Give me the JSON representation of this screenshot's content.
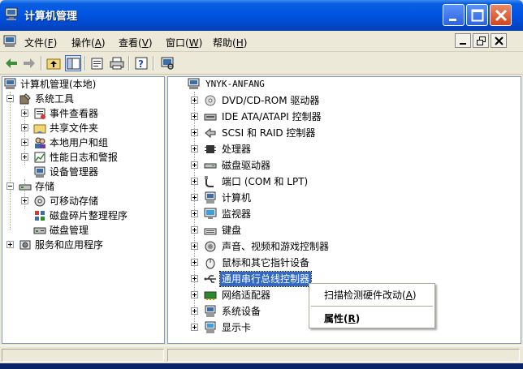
{
  "window": {
    "title": "计算机管理"
  },
  "menu": [
    {
      "label": "文件(",
      "key": "F",
      "end": ")"
    },
    {
      "label": "操作(",
      "key": "A",
      "end": ")"
    },
    {
      "label": "查看(",
      "key": "V",
      "end": ")"
    },
    {
      "label": "窗口(",
      "key": "W",
      "end": ")"
    },
    {
      "label": "帮助(",
      "key": "H",
      "end": ")"
    }
  ],
  "left_tree": [
    {
      "label": "计算机管理(本地)",
      "icon": "computer-management-icon"
    },
    {
      "label": "系统工具",
      "icon": "system-tools-icon"
    },
    {
      "label": "事件查看器",
      "icon": "event-viewer-icon"
    },
    {
      "label": "共享文件夹",
      "icon": "shared-folder-icon"
    },
    {
      "label": "本地用户和组",
      "icon": "users-icon"
    },
    {
      "label": "性能日志和警报",
      "icon": "performance-icon"
    },
    {
      "label": "设备管理器",
      "icon": "device-manager-icon"
    },
    {
      "label": "存储",
      "icon": "storage-icon"
    },
    {
      "label": "可移动存储",
      "icon": "removable-storage-icon"
    },
    {
      "label": "磁盘碎片整理程序",
      "icon": "defrag-icon"
    },
    {
      "label": "磁盘管理",
      "icon": "disk-management-icon"
    },
    {
      "label": "服务和应用程序",
      "icon": "services-icon"
    }
  ],
  "right_tree": {
    "root": "YNYK-ANFANG",
    "items": [
      {
        "label": "DVD/CD-ROM 驱动器",
        "icon": "cdrom-icon"
      },
      {
        "label": "IDE ATA/ATAPI 控制器",
        "icon": "ide-controller-icon"
      },
      {
        "label": "SCSI 和 RAID 控制器",
        "icon": "scsi-icon"
      },
      {
        "label": "处理器",
        "icon": "processor-icon"
      },
      {
        "label": "磁盘驱动器",
        "icon": "disk-drive-icon"
      },
      {
        "label": "端口 (COM 和 LPT)",
        "icon": "port-icon"
      },
      {
        "label": "计算机",
        "icon": "computer-icon"
      },
      {
        "label": "监视器",
        "icon": "monitor-icon"
      },
      {
        "label": "键盘",
        "icon": "keyboard-icon"
      },
      {
        "label": "声音、视频和游戏控制器",
        "icon": "sound-icon"
      },
      {
        "label": "鼠标和其它指针设备",
        "icon": "mouse-icon"
      },
      {
        "label": "通用串行总线控制器",
        "icon": "usb-icon"
      },
      {
        "label": "网络适配器",
        "icon": "network-icon"
      },
      {
        "label": "系统设备",
        "icon": "system-device-icon"
      },
      {
        "label": "显示卡",
        "icon": "display-adapter-icon"
      }
    ],
    "selected_index": 11
  },
  "context_menu": {
    "scan": "扫描检测硬件改动(",
    "scan_key": "A",
    "scan_end": ")",
    "props": "属性(",
    "props_key": "R",
    "props_end": ")"
  },
  "colors": {
    "selection": "#316ac5",
    "titlebar": "#0054e3"
  }
}
